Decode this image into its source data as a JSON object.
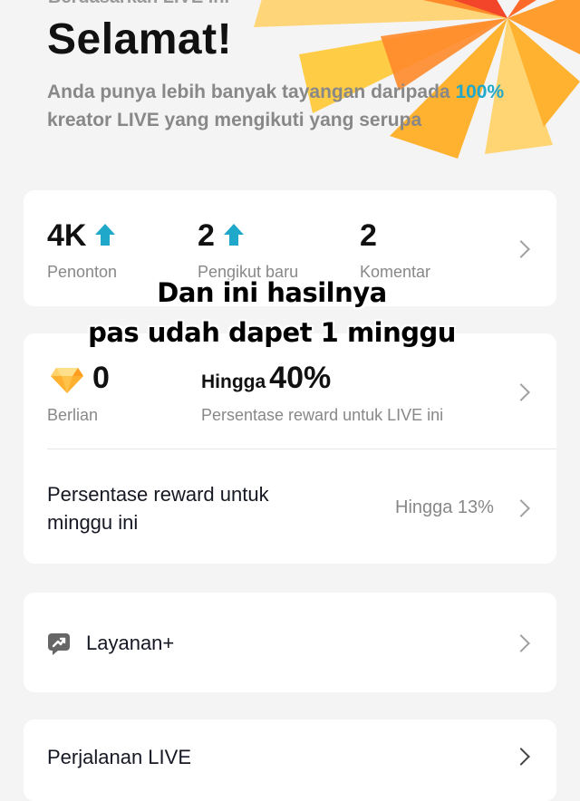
{
  "header": {
    "partial_line": "Berdasarkan LIVE ini",
    "title": "Selamat!",
    "subtitle_pre": "Anda punya lebih banyak tayangan daripada ",
    "subtitle_pct": "100%",
    "subtitle_post": " kreator LIVE yang mengikuti yang serupa"
  },
  "stats": [
    {
      "value": "4K",
      "label": "Penonton",
      "trend": "up"
    },
    {
      "value": "2",
      "label": "Pengikut baru",
      "trend": "up"
    },
    {
      "value": "2",
      "label": "Komentar",
      "trend": "none"
    }
  ],
  "overlay": {
    "line1": "Dan ini hasilnya",
    "line2": "pas udah dapet 1 minggu"
  },
  "rewards": {
    "diamonds_value": "0",
    "diamonds_label": "Berlian",
    "upto_prefix": "Hingga",
    "upto_value": "40%",
    "upto_label": "Persentase reward untuk LIVE ini",
    "weekly_label": "Persentase reward untuk minggu ini",
    "weekly_value": "Hingga 13%"
  },
  "services": {
    "label": "Layanan+",
    "icon": "service-plus-icon"
  },
  "journey": {
    "label": "Perjalanan LIVE"
  },
  "colors": {
    "accent": "#1fa8c9",
    "background": "#f4f4f4",
    "card": "#ffffff",
    "burst_orange": "#ff8a2a",
    "burst_yellow": "#ffc93c",
    "burst_red": "#f2452a"
  }
}
